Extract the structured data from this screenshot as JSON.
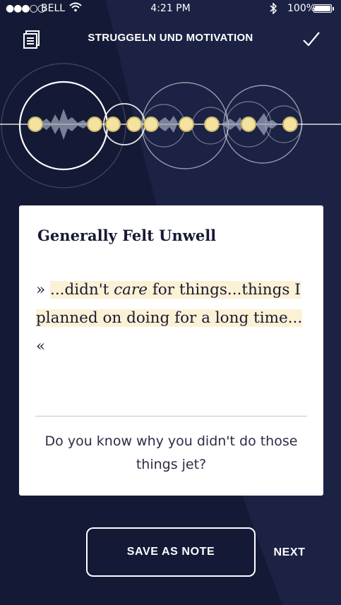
{
  "status_bar": {
    "signal": "●●●○○",
    "carrier": "BELL",
    "time": "4:21 PM",
    "battery_text": "100%",
    "battery_level": 1.0
  },
  "header": {
    "title": "STRUGGELN UND MOTIVATION",
    "left_icon": "notes-icon",
    "right_icon": "checkmark-icon"
  },
  "card": {
    "title": "Generally Felt Unwell",
    "quote_open": "» ",
    "quote_part1": "...didn't ",
    "quote_emphasis": "care",
    "quote_part2": " for things...",
    "quote_part3": "things I planned on doing for a long time...",
    "quote_close": " «",
    "question": "Do you know why you didn't do those things jet?"
  },
  "actions": {
    "save_label": "SAVE AS NOTE",
    "next_label": "NEXT"
  },
  "colors": {
    "background": "#141a36",
    "highlight": "#fbf1d5",
    "marker": "#f4e3a0"
  }
}
